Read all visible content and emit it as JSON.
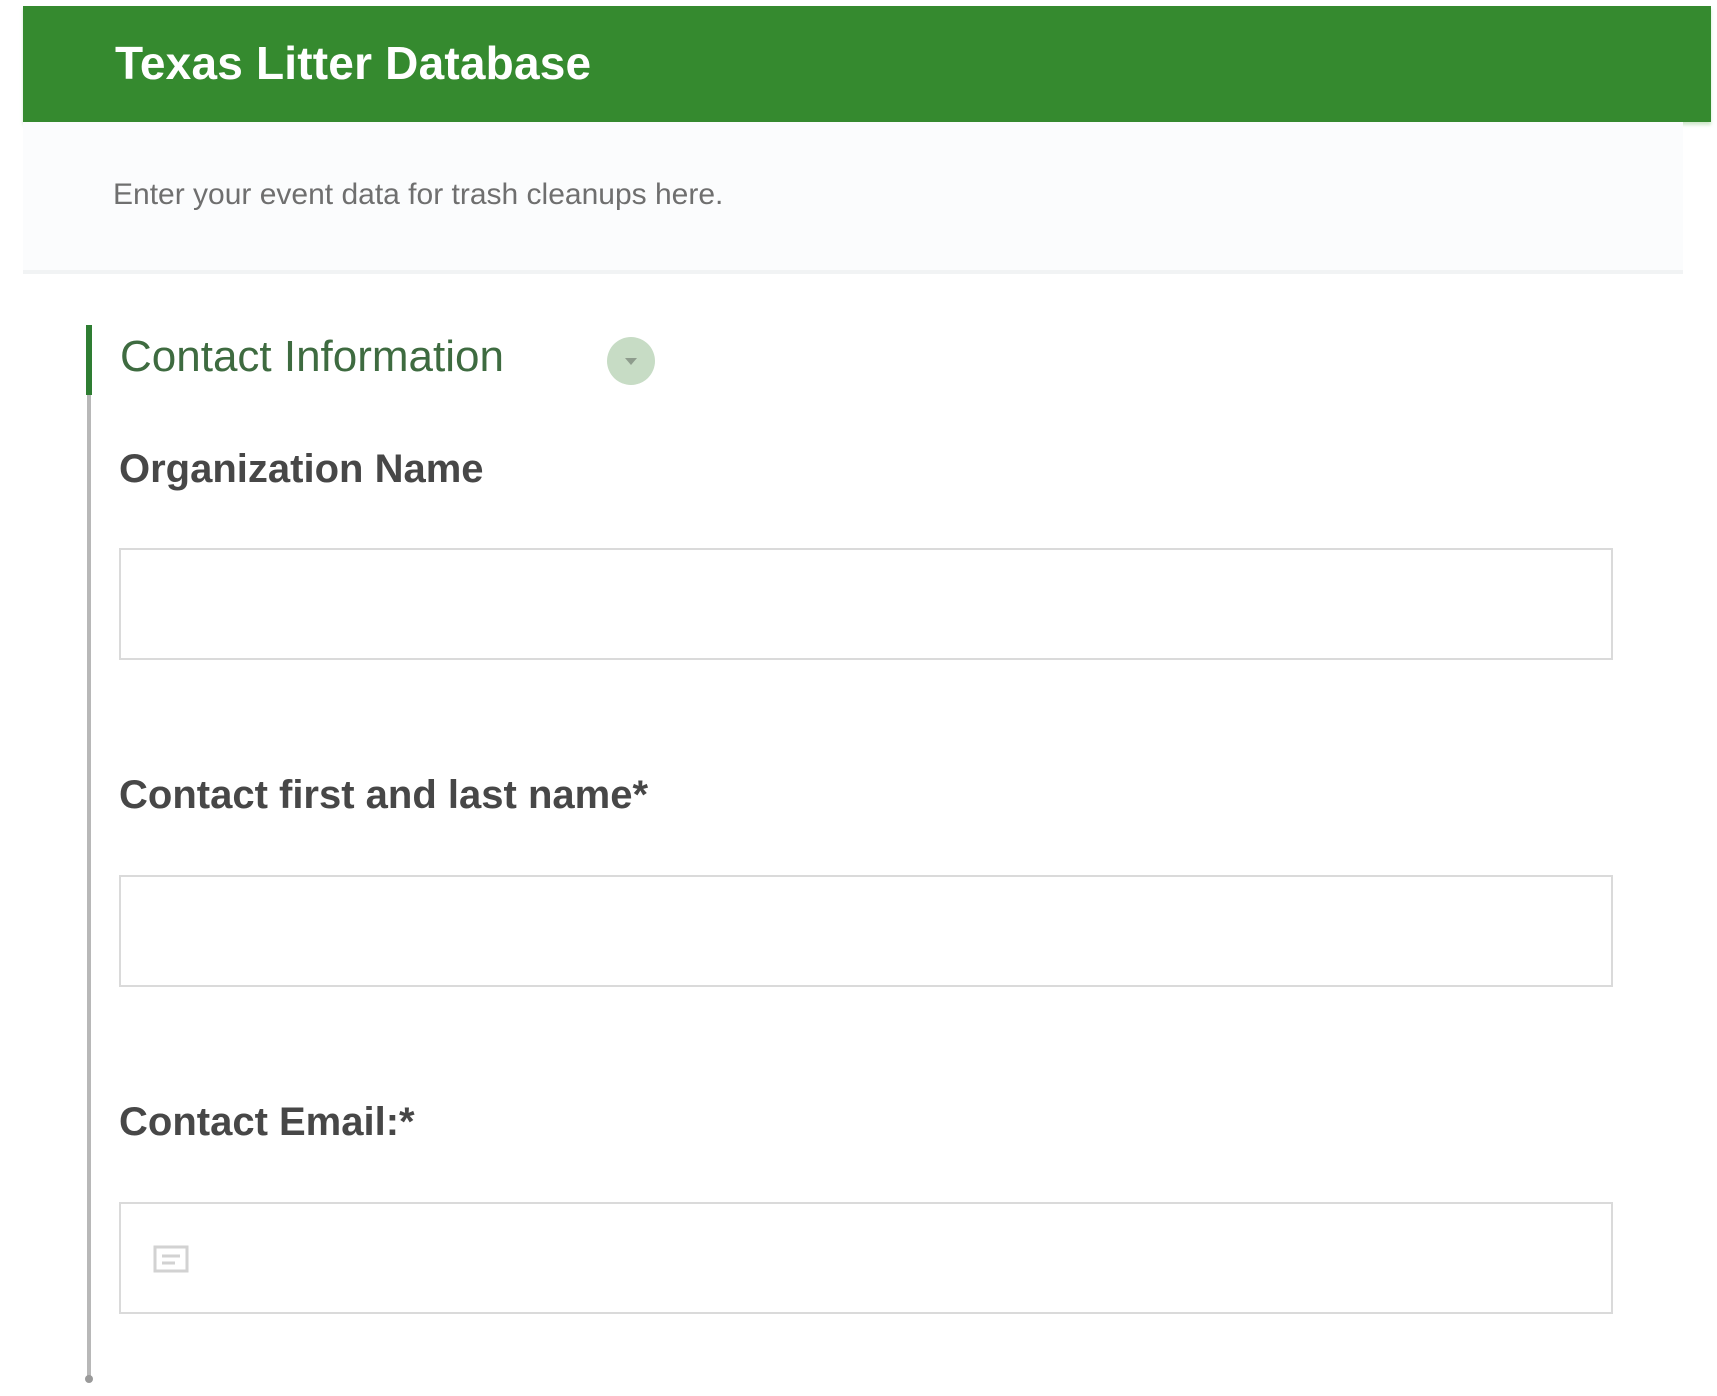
{
  "header": {
    "title": "Texas Litter Database"
  },
  "intro": {
    "text": "Enter your event data for trash cleanups here."
  },
  "section": {
    "title": "Contact Information",
    "toggle_icon": "chevron-down-icon",
    "accent_color": "#2e7d32"
  },
  "fields": [
    {
      "label": "Organization Name",
      "value": "",
      "placeholder": ""
    },
    {
      "label": "Contact first and last name*",
      "value": "",
      "placeholder": ""
    },
    {
      "label": "Contact Email:*",
      "value": "",
      "placeholder": "",
      "icon": "email-icon"
    }
  ],
  "colors": {
    "header_background": "#358a2f",
    "header_text": "#ffffff"
  }
}
